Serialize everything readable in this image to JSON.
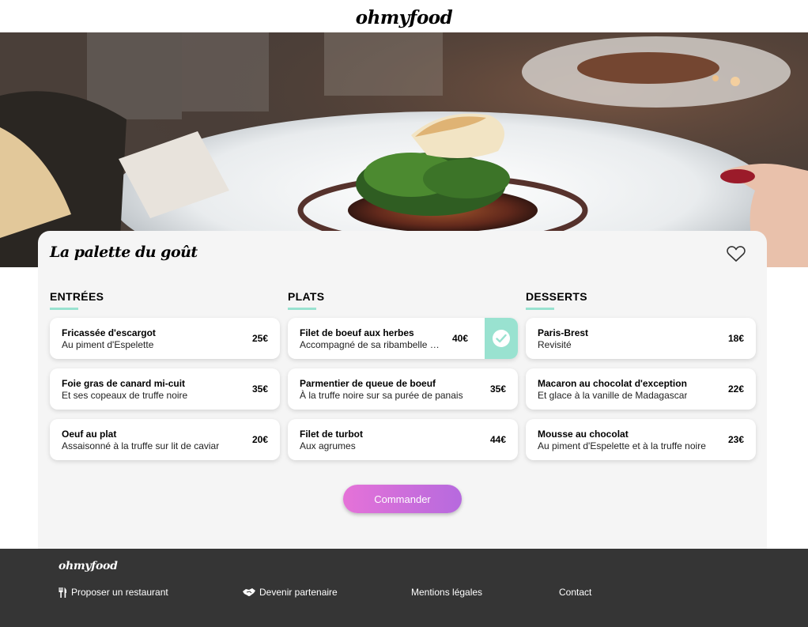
{
  "header": {
    "logo": "ohmyfood"
  },
  "hero": {
    "image": "plated-dish-photo"
  },
  "restaurant": {
    "name": "La palette du goût",
    "like_icon": "heart-outline-icon"
  },
  "menu": {
    "columns": [
      {
        "title": "ENTRÉES",
        "dishes": [
          {
            "name": "Fricassée d'escargot",
            "description": "Au piment d'Espelette",
            "price": "25€"
          },
          {
            "name": "Foie gras de canard mi-cuit",
            "description": "Et ses copeaux de truffe noire",
            "price": "35€"
          },
          {
            "name": "Oeuf au plat",
            "description": "Assaisonné à la truffe sur lit de caviar",
            "price": "20€"
          }
        ]
      },
      {
        "title": "PLATS",
        "dishes": [
          {
            "name": "Filet de boeuf aux herbes",
            "description": "Accompagné de sa ribambelle de légumes",
            "price": "40€",
            "selected": true
          },
          {
            "name": "Parmentier de queue de boeuf",
            "description": "À la truffe noire sur sa purée de panais",
            "price": "35€"
          },
          {
            "name": "Filet de turbot",
            "description": "Aux agrumes",
            "price": "44€"
          }
        ]
      },
      {
        "title": "DESSERTS",
        "dishes": [
          {
            "name": "Paris-Brest",
            "description": "Revisité",
            "price": "18€"
          },
          {
            "name": "Macaron au chocolat d'exception",
            "description": "Et glace à la vanille de Madagascar",
            "price": "22€"
          },
          {
            "name": "Mousse au chocolat",
            "description": "Au piment d'Espelette et à la truffe noire",
            "price": "23€"
          }
        ]
      }
    ],
    "selected_icon": "check-icon"
  },
  "order_button": {
    "label": "Commander"
  },
  "footer": {
    "logo": "ohmyfood",
    "links": [
      {
        "label": "Proposer un restaurant",
        "icon": "utensils-icon"
      },
      {
        "label": "Devenir partenaire",
        "icon": "handshake-icon"
      },
      {
        "label": "Mentions légales"
      },
      {
        "label": "Contact"
      }
    ]
  },
  "colors": {
    "accent": "#99e2d0",
    "button_gradient_start": "#e572d8",
    "button_gradient_end": "#b66ade",
    "card_background": "#f5f5f5",
    "footer_background": "#353535"
  }
}
